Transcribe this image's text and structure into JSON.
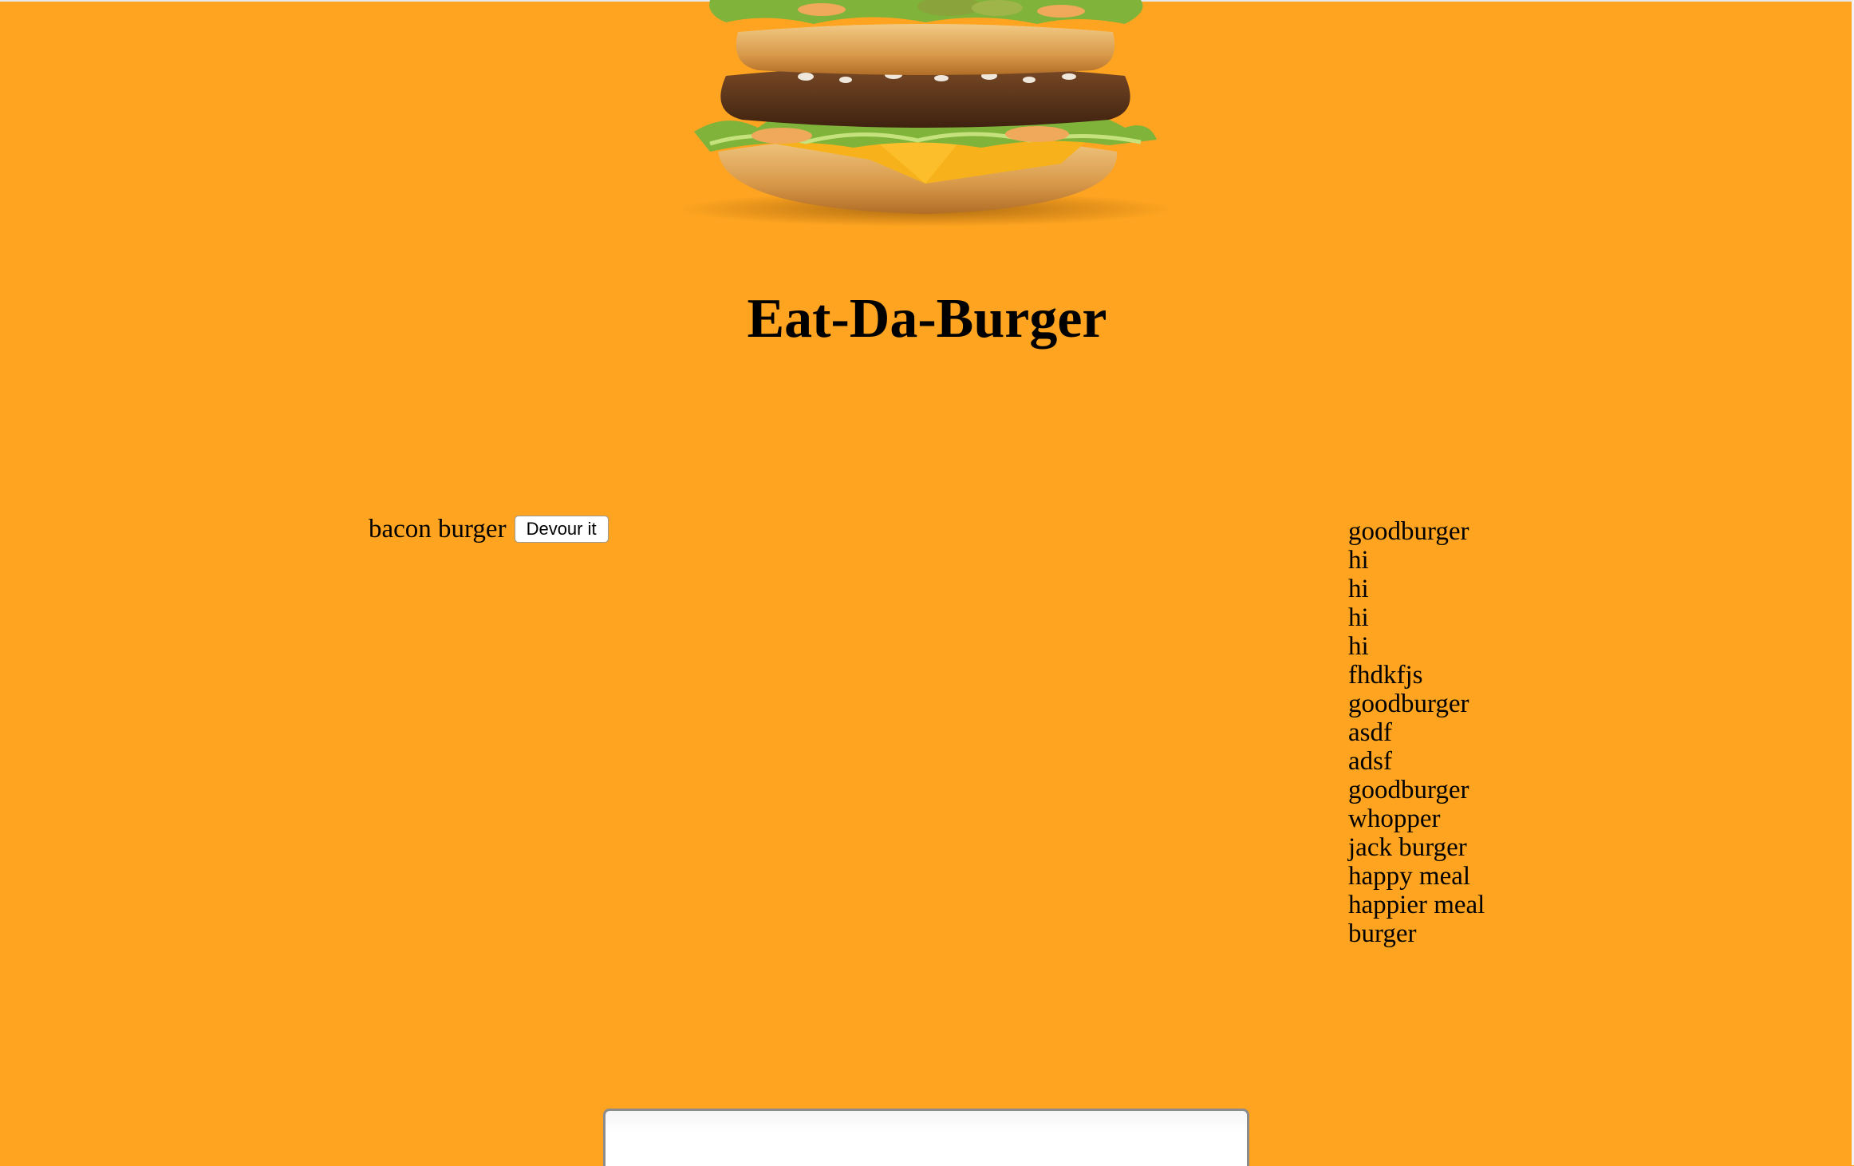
{
  "header": {
    "title": "Eat-Da-Burger",
    "logo": "burger-image"
  },
  "uneaten": [
    {
      "name": "bacon burger",
      "button_label": "Devour it"
    }
  ],
  "eaten": [
    "goodburger",
    "hi",
    "hi",
    "hi",
    "hi",
    "fhdkfjs",
    "goodburger",
    "asdf",
    "adsf",
    "goodburger",
    "whopper",
    "jack burger",
    "happy meal",
    "happier meal",
    "burger"
  ],
  "form": {
    "input_value": "",
    "placeholder": ""
  },
  "colors": {
    "background": "#FEA420"
  }
}
